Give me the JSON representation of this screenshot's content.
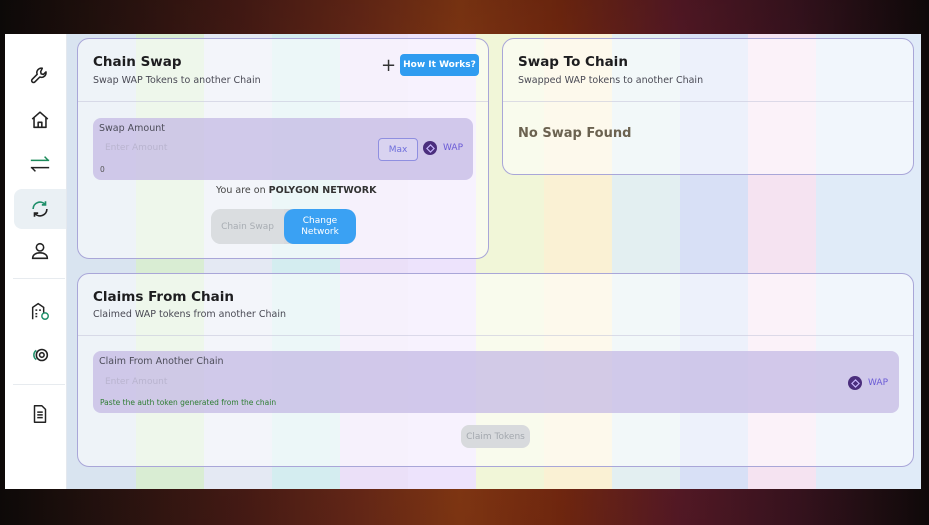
{
  "colors": {
    "accent": "#2f9cf0",
    "card_border": "#a9a6d8",
    "field_bg": "#c4bae4",
    "token_icon": "#4b2e7d",
    "hint_green": "#2e7d32"
  },
  "sidebar": {
    "items": [
      {
        "icon": "wrench-icon"
      },
      {
        "icon": "home-icon"
      },
      {
        "icon": "swap-arrows-icon"
      },
      {
        "icon": "refresh-cycle-icon",
        "active": true
      },
      {
        "icon": "user-icon"
      },
      {
        "icon": "building-icon"
      },
      {
        "icon": "coins-icon"
      },
      {
        "icon": "document-icon"
      }
    ]
  },
  "chain_swap": {
    "title": "Chain Swap",
    "subtitle": "Swap WAP Tokens to another Chain",
    "how_it_works": "How It Works?",
    "plus_icon": "+",
    "amount_label": "Swap Amount",
    "amount_placeholder": "Enter Amount",
    "balance": "0",
    "max_label": "Max",
    "token": "WAP",
    "network_prefix": "You are on",
    "network_name": "POLYGON NETWORK",
    "toggle_off": "Chain Swap",
    "toggle_on": "Change Network"
  },
  "swap_to_chain": {
    "title": "Swap To Chain",
    "subtitle": "Swapped WAP tokens to another Chain",
    "empty": "No Swap Found"
  },
  "claims": {
    "title": "Claims From Chain",
    "subtitle": "Claimed WAP tokens from another Chain",
    "field_label": "Claim From Another Chain",
    "placeholder": "Enter Amount",
    "token": "WAP",
    "hint": "Paste the auth token generated from the chain",
    "claim_button": "Claim Tokens"
  }
}
